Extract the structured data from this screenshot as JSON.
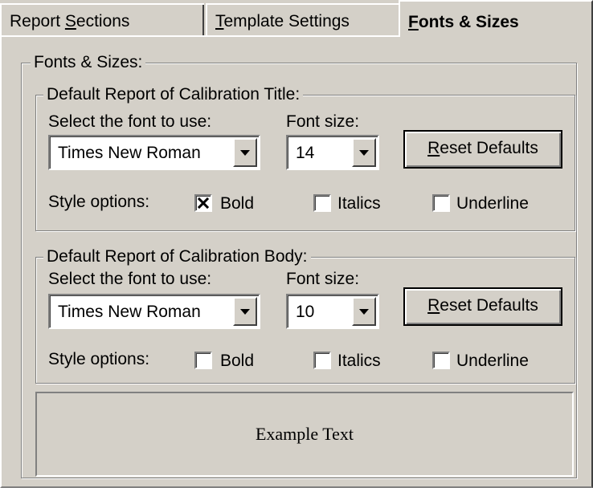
{
  "tabs": {
    "report_sections": {
      "pre": "Report ",
      "mnemonic": "S",
      "post": "ections"
    },
    "template_settings": {
      "pre": "",
      "mnemonic": "T",
      "post": "emplate Settings"
    },
    "fonts_sizes": {
      "pre": "",
      "mnemonic": "F",
      "post": "onts & Sizes"
    }
  },
  "group_title": "Fonts & Sizes:",
  "sections": {
    "title": {
      "legend": "Default Report of Calibration Title:",
      "font_label": "Select the font to use:",
      "font_value": "Times New Roman",
      "size_label": "Font size:",
      "size_value": "14",
      "reset_pre": "",
      "reset_mnemonic": "R",
      "reset_post": "eset Defaults",
      "style_label": "Style options:",
      "bold": "Bold",
      "italics": "Italics",
      "underline": "Underline",
      "bold_checked": true,
      "italics_checked": false,
      "underline_checked": false
    },
    "body": {
      "legend": "Default Report of Calibration Body:",
      "font_label": "Select the font to use:",
      "font_value": "Times New Roman",
      "size_label": "Font size:",
      "size_value": "10",
      "reset_pre": "",
      "reset_mnemonic": "R",
      "reset_post": "eset Defaults",
      "style_label": "Style options:",
      "bold": "Bold",
      "italics": "Italics",
      "underline": "Underline",
      "bold_checked": false,
      "italics_checked": false,
      "underline_checked": false
    }
  },
  "example_text": "Example Text"
}
